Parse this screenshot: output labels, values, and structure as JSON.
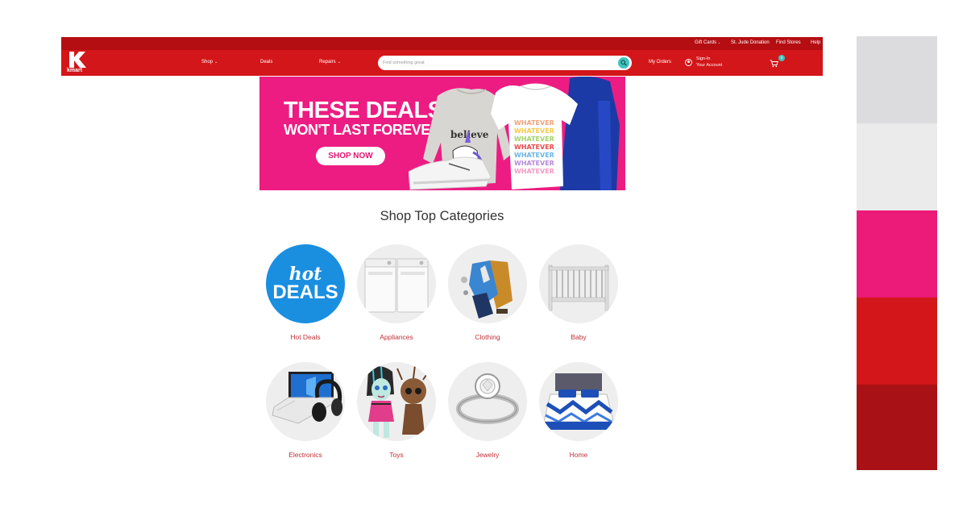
{
  "utility": {
    "gift_cards": "Gift Cards",
    "st_jude": "St. Jude Donation",
    "find_stores": "Find Stores",
    "help": "Help"
  },
  "header": {
    "logo_text": "kmart",
    "nav": {
      "shop": "Shop",
      "deals": "Deals",
      "repairs": "Repairs"
    },
    "search_placeholder": "Find something great",
    "my_orders": "My Orders",
    "sign_in": "Sign-In",
    "your_account": "Your Account",
    "cart_count": "0"
  },
  "hero": {
    "headline": "THESE DEALS",
    "subheadline": "WON'T LAST FOREVER!",
    "cta": "SHOP NOW",
    "shirt_text_1": "believe",
    "shirt_text_2": "WHATEVER"
  },
  "categories": {
    "title": "Shop Top Categories",
    "hot_deals_badge_1": "hot",
    "hot_deals_badge_2": "DEALS",
    "items": [
      {
        "label": "Hot Deals",
        "icon": "hot-deals-badge"
      },
      {
        "label": "Appliances",
        "icon": "washer-dryer-icon"
      },
      {
        "label": "Clothing",
        "icon": "clothing-icon"
      },
      {
        "label": "Baby",
        "icon": "crib-icon"
      },
      {
        "label": "Electronics",
        "icon": "laptop-headphones-icon"
      },
      {
        "label": "Toys",
        "icon": "toys-icon"
      },
      {
        "label": "Jewelry",
        "icon": "ring-icon"
      },
      {
        "label": "Home",
        "icon": "bedding-icon"
      }
    ]
  },
  "palette": [
    "#dcdcdf",
    "#ebebeb",
    "#ec1a78",
    "#d31619",
    "#a81115"
  ]
}
